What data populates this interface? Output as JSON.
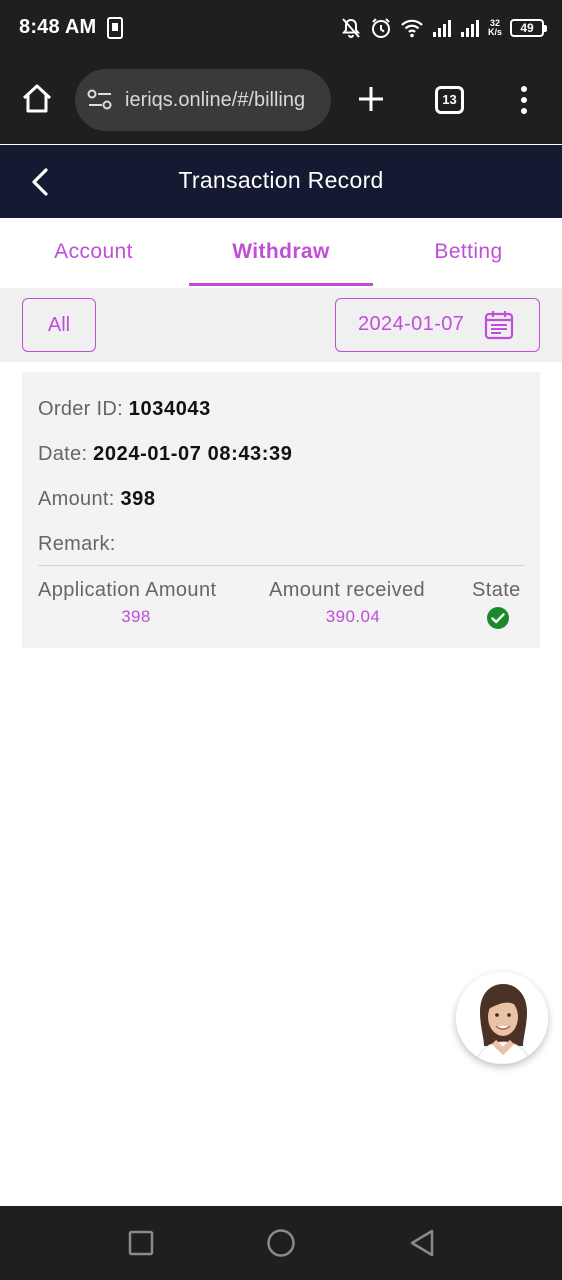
{
  "status_bar": {
    "time": "8:48 AM",
    "speed_value": "32",
    "speed_unit": "K/s",
    "battery": "49",
    "icons": [
      "sim-card-icon",
      "bell-off-icon",
      "alarm-icon",
      "wifi-icon",
      "signal-icon",
      "signal-icon",
      "battery-icon"
    ]
  },
  "browser": {
    "url": "ieriqs.online/#/billing",
    "tabs_count": "13",
    "icons": [
      "home-icon",
      "tune-icon",
      "plus-icon",
      "more-vert-icon"
    ]
  },
  "header": {
    "title": "Transaction Record",
    "back_icon": "chevron-left-icon"
  },
  "tabs": [
    {
      "label": "Account",
      "active": false
    },
    {
      "label": "Withdraw",
      "active": true
    },
    {
      "label": "Betting",
      "active": false
    }
  ],
  "filters": {
    "all_label": "All",
    "date_value": "2024-01-07",
    "date_icon": "calendar-icon"
  },
  "record": {
    "order_id_label": "Order ID:",
    "order_id_value": "1034043",
    "date_label": "Date:",
    "date_value": "2024-01-07 08:43:39",
    "amount_label": "Amount:",
    "amount_value": "398",
    "remark_label": "Remark:",
    "remark_value": "",
    "columns": [
      {
        "header": "Application Amount",
        "value": "398"
      },
      {
        "header": "Amount received",
        "value": "390.04"
      },
      {
        "header": "State",
        "value": ""
      }
    ],
    "state_icon": "check-circle-icon",
    "state_color": "#1a8a2a"
  },
  "colors": {
    "accent": "#c04ed9",
    "header_bg": "#151a33",
    "system_bar_bg": "#1f1f1f"
  },
  "support": {
    "avatar_icon": "support-agent-avatar"
  },
  "nav_bar": {
    "icons": [
      "recent-apps-icon",
      "home-circle-icon",
      "back-triangle-icon"
    ]
  }
}
